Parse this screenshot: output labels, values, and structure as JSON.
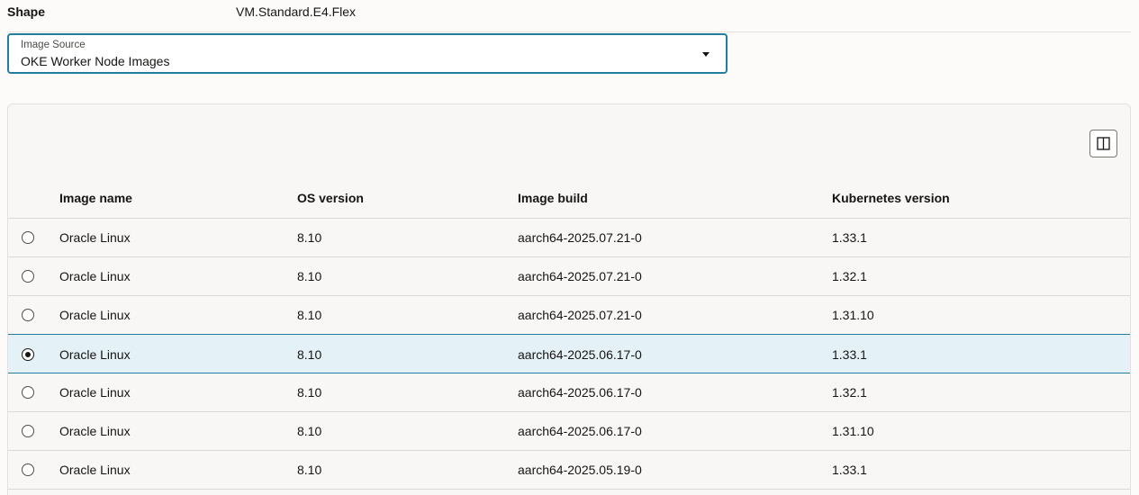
{
  "shape": {
    "label": "Shape",
    "value": "VM.Standard.E4.Flex"
  },
  "image_source": {
    "label": "Image Source",
    "value": "OKE Worker Node Images"
  },
  "table": {
    "columns": {
      "name": "Image name",
      "os": "OS version",
      "build": "Image build",
      "k8s": "Kubernetes version"
    },
    "rows": [
      {
        "name": "Oracle Linux",
        "os": "8.10",
        "build": "aarch64-2025.07.21-0",
        "k8s": "1.33.1",
        "selected": false
      },
      {
        "name": "Oracle Linux",
        "os": "8.10",
        "build": "aarch64-2025.07.21-0",
        "k8s": "1.32.1",
        "selected": false
      },
      {
        "name": "Oracle Linux",
        "os": "8.10",
        "build": "aarch64-2025.07.21-0",
        "k8s": "1.31.10",
        "selected": false
      },
      {
        "name": "Oracle Linux",
        "os": "8.10",
        "build": "aarch64-2025.06.17-0",
        "k8s": "1.33.1",
        "selected": true
      },
      {
        "name": "Oracle Linux",
        "os": "8.10",
        "build": "aarch64-2025.06.17-0",
        "k8s": "1.32.1",
        "selected": false
      },
      {
        "name": "Oracle Linux",
        "os": "8.10",
        "build": "aarch64-2025.06.17-0",
        "k8s": "1.31.10",
        "selected": false
      },
      {
        "name": "Oracle Linux",
        "os": "8.10",
        "build": "aarch64-2025.05.19-0",
        "k8s": "1.33.1",
        "selected": false
      }
    ]
  },
  "icons": {
    "columns_toggle": "columns-icon",
    "select_caret": "caret-down-icon"
  },
  "colors": {
    "accent": "#227e9e",
    "selected_row": "#e4f1f6"
  }
}
